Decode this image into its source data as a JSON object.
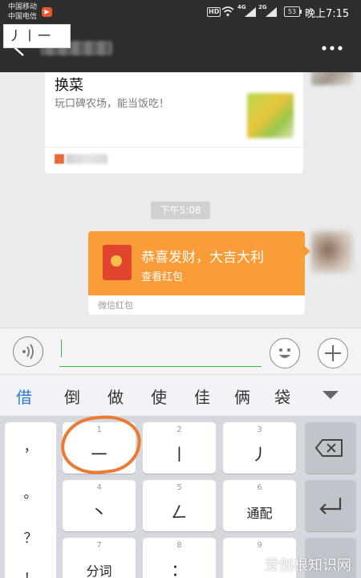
{
  "status_bar": {
    "carrier_1": "中国移动",
    "carrier_2": "中国电信",
    "hd": "HD",
    "gen_1": "4G",
    "gen_2": "2G",
    "battery": "53",
    "time": "晚上7:15"
  },
  "nav": {
    "contact_name": "",
    "icons": {
      "back": "chevron-left-icon",
      "more": "more-dots-icon"
    }
  },
  "chat": {
    "link_card": {
      "title": "换菜",
      "description": "玩口碑农场，能当饭吃！",
      "source": ""
    },
    "timestamp": "下午5:08",
    "red_packet": {
      "title": "恭喜发财，大吉大利",
      "action": "查看红包",
      "brand": "微信红包"
    },
    "colors": {
      "red_packet": "#f79c36",
      "background": "#ebebeb"
    }
  },
  "input_bar": {
    "composition": "丿丨一",
    "icons": {
      "voice": "voice-icon",
      "emoji": "emoji-icon",
      "more": "plus-icon"
    }
  },
  "candidates": [
    "借",
    "倒",
    "做",
    "使",
    "佳",
    "俩",
    "袋"
  ],
  "keyboard": {
    "punctuation": [
      "，",
      "。",
      "？",
      "！"
    ],
    "keys": [
      {
        "num": "1",
        "label": "一"
      },
      {
        "num": "2",
        "label": "丨"
      },
      {
        "num": "3",
        "label": "丿"
      },
      {
        "num": "4",
        "label": "丶"
      },
      {
        "num": "5",
        "label": "𠃋"
      },
      {
        "num": "6",
        "label": "通配"
      },
      {
        "num": "7",
        "label": "分词"
      },
      {
        "num": "8",
        "label": "："
      },
      {
        "num": "9",
        "label": ""
      }
    ],
    "icons": {
      "backspace": "backspace-icon",
      "enter": "enter-icon"
    }
  },
  "watermark": "爱刨根知识网"
}
